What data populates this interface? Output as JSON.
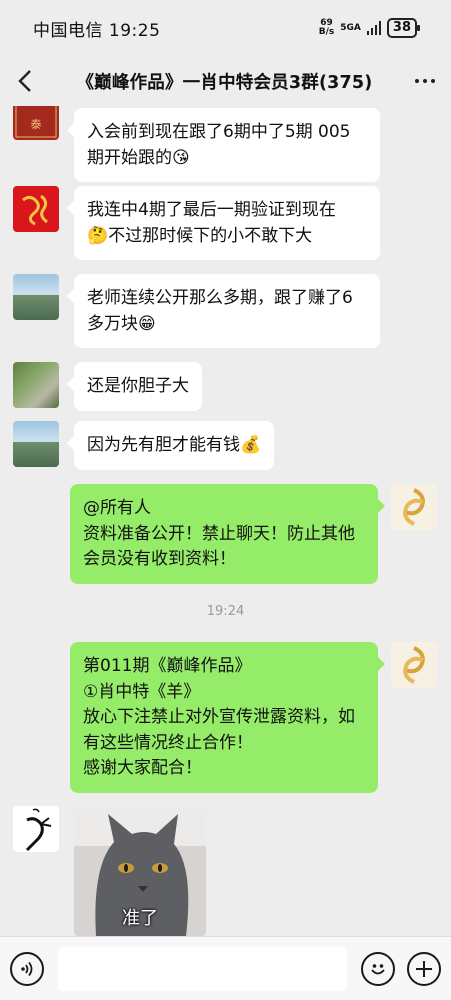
{
  "status": {
    "carrier_time": "中国电信 19:25",
    "speed_value": "69",
    "speed_unit": "B/s",
    "network": "5GA",
    "battery": "38"
  },
  "nav": {
    "title": "《巅峰作品》一肖中特会员3群(375)",
    "back_icon": "chevron-left-icon",
    "more_icon": "more-dots-icon"
  },
  "messages": [
    {
      "side": "in",
      "text": "入会前到现在跟了6期中了5期 005期开始跟的",
      "emoji": "😘",
      "avatar": "red-seal-avatar"
    },
    {
      "side": "in",
      "text_pre": "我连中4期了最后一期验证到现在",
      "emoji": "🤔",
      "text_post": "不过那时候下的小不敢下大",
      "avatar": "red-calligraphy-avatar"
    },
    {
      "side": "in",
      "text": "老师连续公开那么多期，跟了赚了6多万块",
      "emoji": "😁",
      "avatar": "lakeside-avatar"
    },
    {
      "side": "in",
      "text": "还是你胆子大",
      "avatar": "garden-avatar"
    },
    {
      "side": "in",
      "text": "因为先有胆才能有钱",
      "emoji": "💰",
      "avatar": "lakeside-avatar"
    },
    {
      "side": "out",
      "lines": [
        "@所有人",
        "资料准备公开！禁止聊天！防止其他会员没有收到资料！"
      ],
      "avatar": "gold-fish-avatar"
    },
    {
      "side": "out",
      "lines": [
        "第011期《巅峰作品》",
        "①肖中特《羊》",
        "放心下注禁止对外宣传泄露资料，如有这些情况终止合作！",
        "感谢大家配合！"
      ],
      "avatar": "gold-fish-avatar"
    },
    {
      "side": "in",
      "type": "image",
      "caption": "准了",
      "avatar": "ink-fish-avatar"
    }
  ],
  "timestamp": "19:24",
  "input": {
    "voice_icon": "voice-icon",
    "emoji_icon": "emoji-icon",
    "plus_icon": "plus-icon",
    "placeholder": ""
  },
  "colors": {
    "background": "#ededed",
    "incoming_bubble": "#ffffff",
    "outgoing_bubble": "#95ec69",
    "timestamp": "#9a9a9a"
  }
}
